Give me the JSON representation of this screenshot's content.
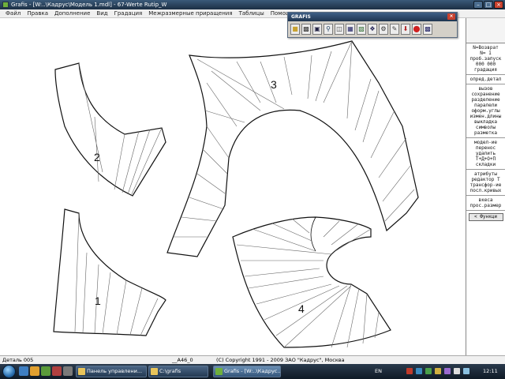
{
  "window": {
    "title": "Grafis - [W:..\\Кадрус\\Модель 1.mdl] - 67-Werte Rutip_W"
  },
  "menu": [
    "Файл",
    "Правка",
    "Дополнение",
    "Вид",
    "Градация",
    "Межразмерные приращения",
    "Таблицы",
    "Помощь"
  ],
  "toolbox": {
    "title": "GRAFIS",
    "buttons": [
      "open-icon",
      "print-icon",
      "save-icon",
      "zoom-icon",
      "zoom-window-icon",
      "grid-icon",
      "layers-icon",
      "measure-icon",
      "settings-icon",
      "pencil-icon",
      "arrow-down-icon",
      "stop-icon",
      "export-icon"
    ]
  },
  "pieces": [
    {
      "id": "piece-1",
      "label": "1"
    },
    {
      "id": "piece-2",
      "label": "2"
    },
    {
      "id": "piece-3",
      "label": "3"
    },
    {
      "id": "piece-4",
      "label": "4"
    }
  ],
  "sidepanel": {
    "header": [
      "N=Возврат",
      "N=  1",
      "проб.запуск",
      "000 000",
      "градация"
    ],
    "group1": [
      "опред.детал"
    ],
    "group2": [
      "вызов",
      "сохранение",
      "разделение",
      "паралели",
      "оформ.углы",
      "измен.длины",
      "выкладка",
      "символы",
      "разметка"
    ],
    "group3": [
      "модел-ие",
      "перенос",
      "удалить",
      "Т+Д+О+П",
      "складки"
    ],
    "group4": [
      "атрибуты",
      "редактор Т",
      "трансфор-ие",
      "посл.кривых"
    ],
    "group5": [
      "вкеса",
      "прос.размер"
    ],
    "func_button": "< Функци"
  },
  "status": {
    "detail": "Деталь 005",
    "code": "__A46_0",
    "copyright": "(C) Copyright 1991 - 2009 ЗАО \"Кадрус\", Москва"
  },
  "taskbar": {
    "tasks": [
      "Панель управлени...",
      "C:\\grafis",
      "Grafis - [W:..\\Кадрус..."
    ],
    "lang": "EN",
    "clock": "12:11"
  }
}
